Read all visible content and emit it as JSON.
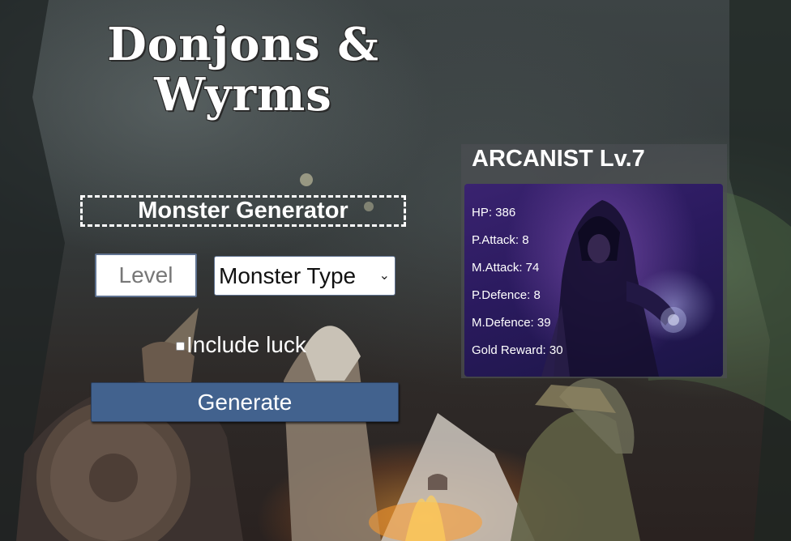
{
  "app": {
    "title_line1": "Donjons &",
    "title_line2": "Wyrms"
  },
  "generator": {
    "heading": "Monster Generator",
    "level_placeholder": "Level",
    "monster_type_selected": "Monster Type",
    "include_luck_label": "Include luck",
    "include_luck_checked": false,
    "generate_label": "Generate"
  },
  "monster": {
    "name": "ARCANIST Lv.7",
    "stats": [
      "HP: 386",
      "P.Attack: 8",
      "M.Attack: 74",
      "P.Defence: 8",
      "M.Defence: 39",
      "Gold Reward: 30"
    ]
  },
  "colors": {
    "button_bg": "#42628e",
    "portrait_bg": "#2a1a5e",
    "text": "#ffffff"
  },
  "icons": {
    "select_arrow": "chevron-down-icon"
  }
}
